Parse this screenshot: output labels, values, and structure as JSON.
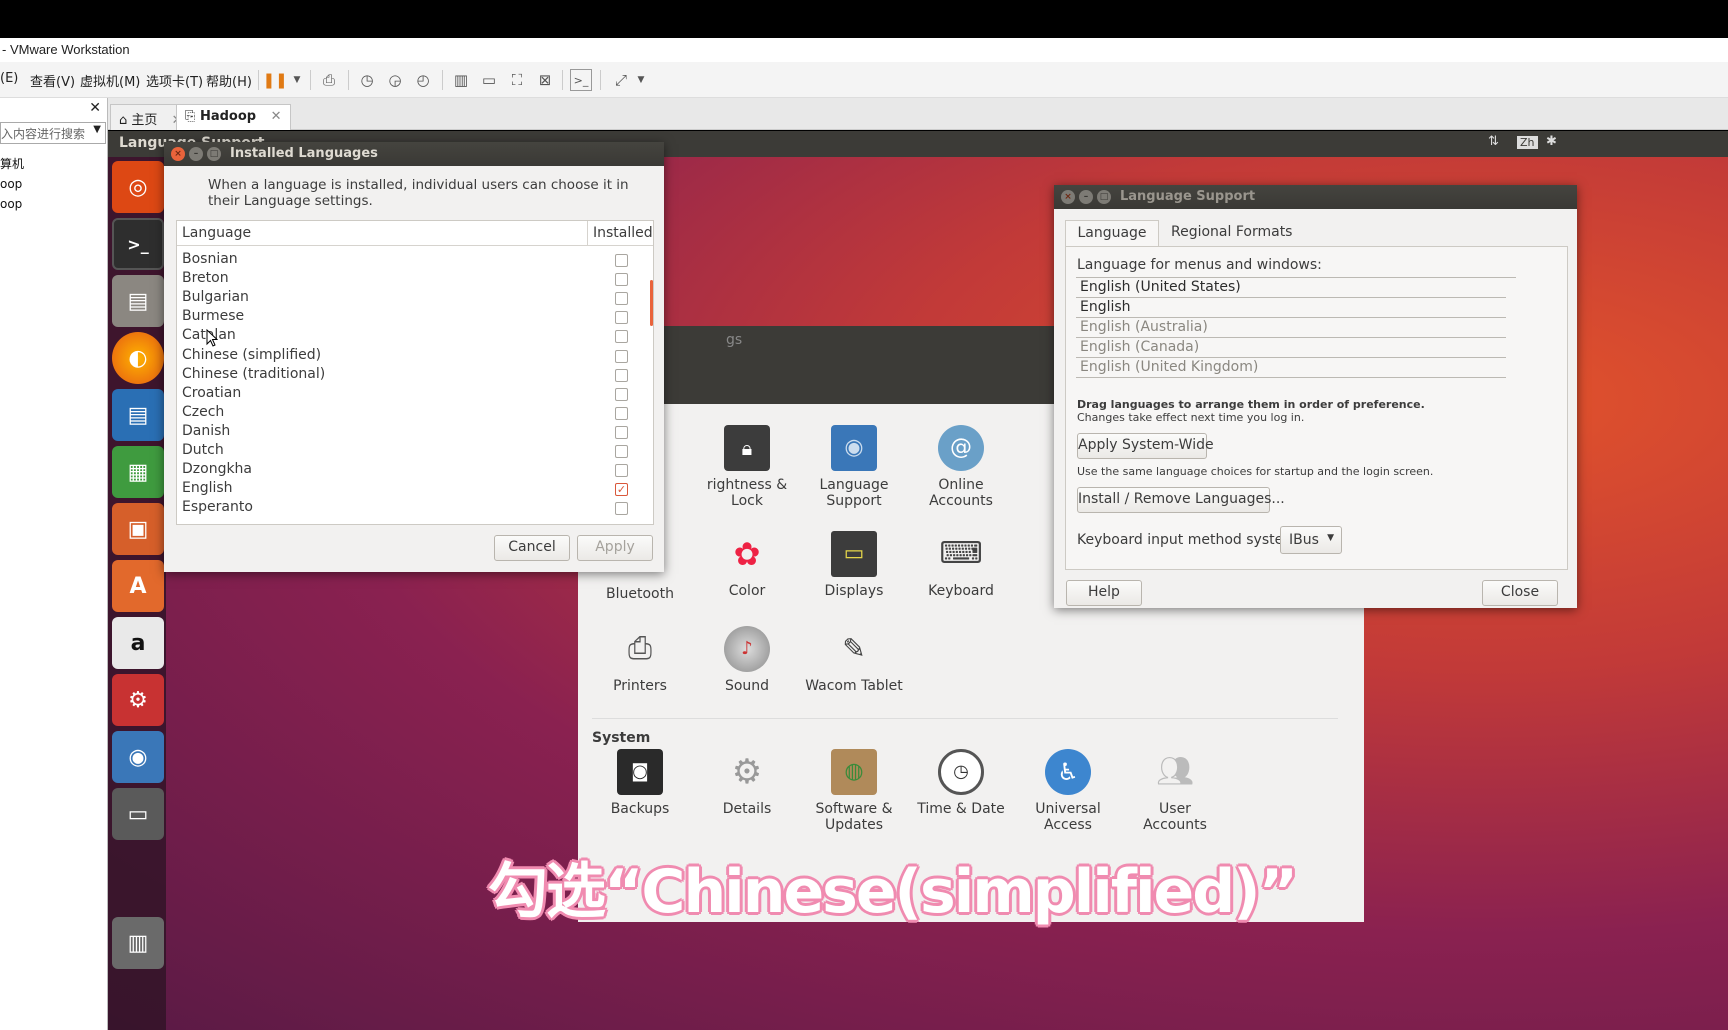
{
  "vmware": {
    "title": "- VMware Workstation",
    "menu": [
      "(E)",
      "查看(V)",
      "虚拟机(M)",
      "选项卡(T)",
      "帮助(H)"
    ],
    "library": {
      "search_placeholder": "入内容进行搜索",
      "tree": [
        "算机",
        "oop",
        "oop"
      ]
    },
    "tabs": [
      {
        "label": "主页",
        "icon": "home-icon"
      },
      {
        "label": "Hadoop",
        "icon": "vm-icon"
      }
    ]
  },
  "ubuntu": {
    "panel_title": "Language Support",
    "indicators": [
      "⇅",
      "Zh",
      "✱"
    ],
    "launcher": [
      "ubuntu-dash-icon",
      "terminal-icon",
      "files-icon",
      "firefox-icon",
      "writer-icon",
      "calc-icon",
      "impress-icon",
      "software-center-icon",
      "amazon-icon",
      "system-settings-icon",
      "language-support-icon",
      "save-icon",
      "trash-icon"
    ]
  },
  "settings": {
    "title_fragment": "gs",
    "personal_items": [
      {
        "label": "rightness &\nLock",
        "icon": "lock-icon"
      },
      {
        "label": "Language\nSupport",
        "icon": "language-support-icon"
      },
      {
        "label": "Online\nAccounts",
        "icon": "online-accounts-icon"
      }
    ],
    "hardware_items": [
      {
        "label": "Bluetooth",
        "icon": "bluetooth-icon"
      },
      {
        "label": "Color",
        "icon": "color-icon"
      },
      {
        "label": "Displays",
        "icon": "displays-icon"
      },
      {
        "label": "Keyboard",
        "icon": "keyboard-icon"
      },
      {
        "label": "Printers",
        "icon": "printer-icon"
      },
      {
        "label": "Sound",
        "icon": "sound-icon"
      },
      {
        "label": "Wacom Tablet",
        "icon": "wacom-tablet-icon"
      }
    ],
    "system_heading": "System",
    "system_items": [
      {
        "label": "Backups",
        "icon": "backups-icon"
      },
      {
        "label": "Details",
        "icon": "details-icon"
      },
      {
        "label": "Software &\nUpdates",
        "icon": "software-updates-icon"
      },
      {
        "label": "Time & Date",
        "icon": "clock-icon"
      },
      {
        "label": "Universal\nAccess",
        "icon": "universal-access-icon"
      },
      {
        "label": "User\nAccounts",
        "icon": "user-accounts-icon"
      }
    ]
  },
  "installed": {
    "title": "Installed Languages",
    "intro": "When a language is installed, individual users can choose it in their Language settings.",
    "col_language": "Language",
    "col_installed": "Installed",
    "rows": [
      {
        "name": "Bosnian",
        "installed": false
      },
      {
        "name": "Breton",
        "installed": false
      },
      {
        "name": "Bulgarian",
        "installed": false
      },
      {
        "name": "Burmese",
        "installed": false
      },
      {
        "name": "Catalan",
        "installed": false
      },
      {
        "name": "Chinese (simplified)",
        "installed": false
      },
      {
        "name": "Chinese (traditional)",
        "installed": false
      },
      {
        "name": "Croatian",
        "installed": false
      },
      {
        "name": "Czech",
        "installed": false
      },
      {
        "name": "Danish",
        "installed": false
      },
      {
        "name": "Dutch",
        "installed": false
      },
      {
        "name": "Dzongkha",
        "installed": false
      },
      {
        "name": "English",
        "installed": true
      },
      {
        "name": "Esperanto",
        "installed": false
      }
    ],
    "cancel": "Cancel",
    "apply": "Apply"
  },
  "langsupport": {
    "title": "Language Support",
    "tab_language": "Language",
    "tab_regional": "Regional Formats",
    "menus_label": "Language for menus and windows:",
    "languages": [
      {
        "name": "English (United States)",
        "active": true
      },
      {
        "name": "English",
        "active": true
      },
      {
        "name": "English (Australia)",
        "active": false
      },
      {
        "name": "English (Canada)",
        "active": false
      },
      {
        "name": "English (United Kingdom)",
        "active": false
      }
    ],
    "drag_hint": "Drag languages to arrange them in order of preference.",
    "drag_sub": "Changes take effect next time you log in.",
    "apply_system_wide": "Apply System-Wide",
    "system_wide_hint": "Use the same language choices for startup and the login screen.",
    "install_remove": "Install / Remove Languages...",
    "keyboard_label": "Keyboard input method system:",
    "keyboard_value": "IBus",
    "help": "Help",
    "close": "Close"
  },
  "caption": "勾选“Chinese(simplified)”"
}
